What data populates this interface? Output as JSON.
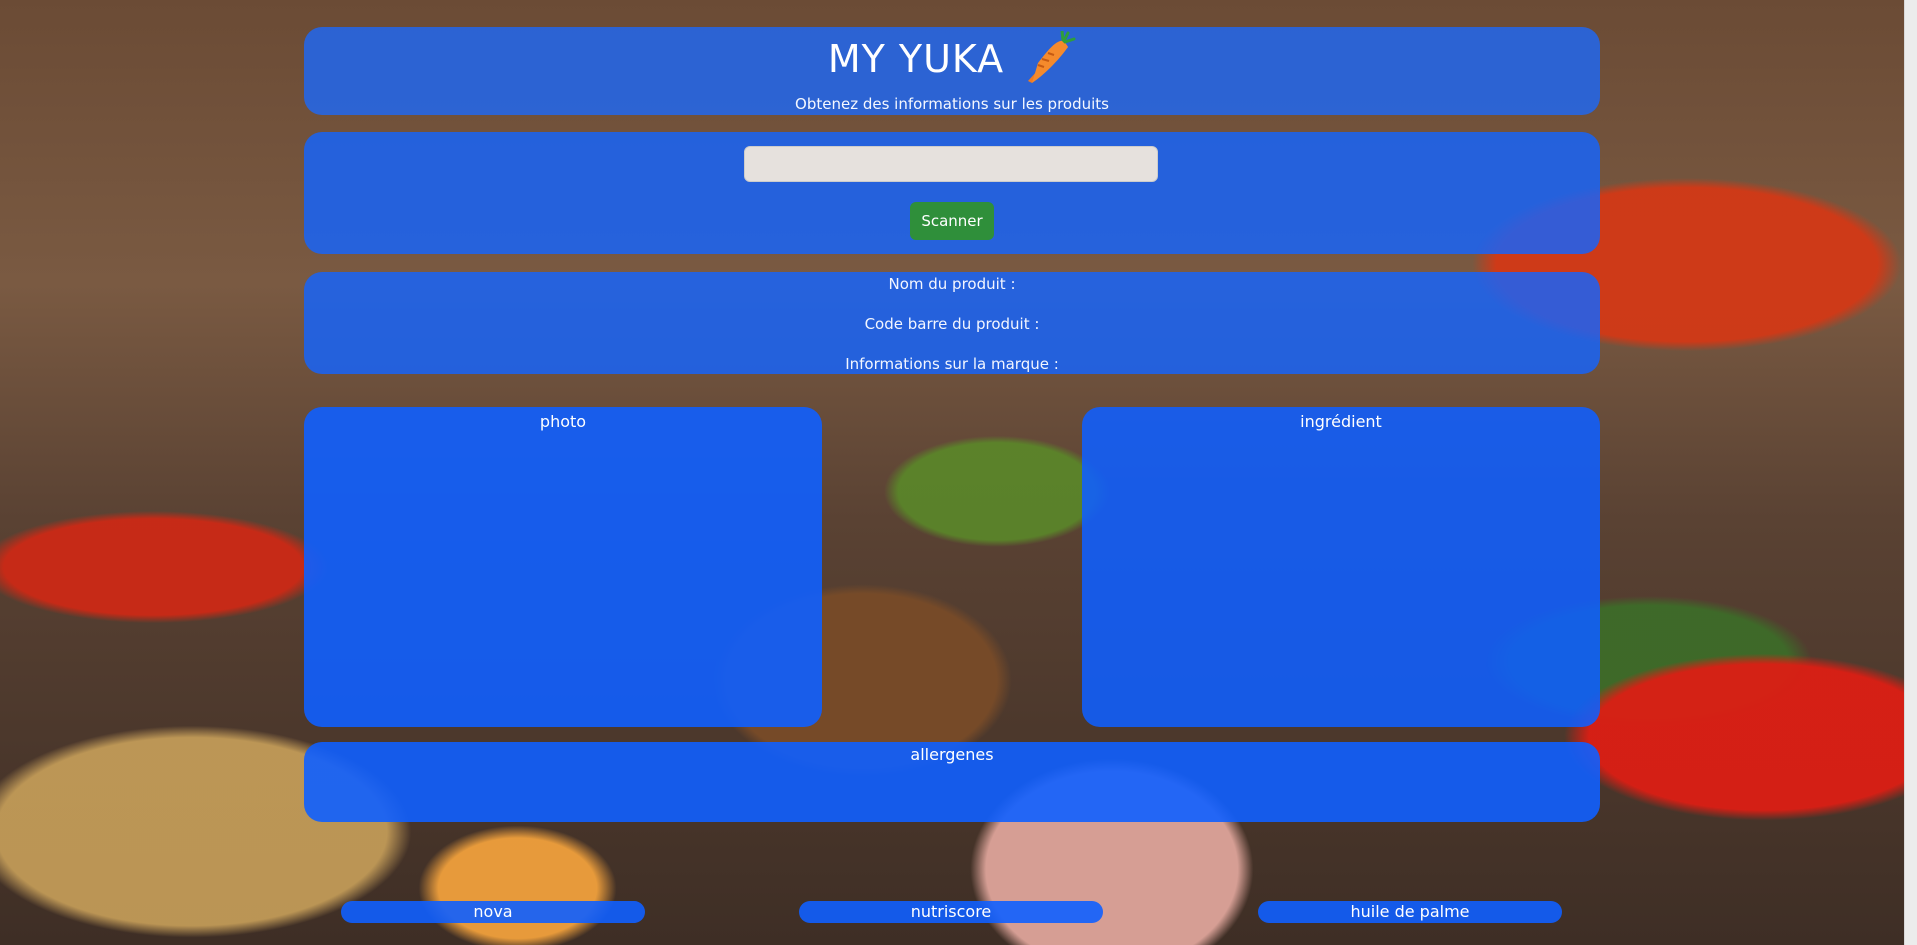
{
  "header": {
    "title": "MY YUKA",
    "subtitle": "Obtenez des informations sur les produits",
    "logo_icon": "carrot-icon"
  },
  "search": {
    "value": "",
    "placeholder": "",
    "button_label": "Scanner"
  },
  "product_info": {
    "name_label": "Nom du produit :",
    "barcode_label": "Code barre du produit :",
    "brand_label": "Informations sur la marque :"
  },
  "sections": {
    "photo": "photo",
    "ingredients": "ingrédient",
    "allergens": "allergenes"
  },
  "scores": {
    "nova": "nova",
    "nutriscore": "nutriscore",
    "palm_oil": "huile de palme"
  },
  "colors": {
    "panel_blue": "#1464ff",
    "button_green": "#2f8f3a",
    "carrot_orange": "#f07a22",
    "carrot_green": "#2e9e3c"
  }
}
